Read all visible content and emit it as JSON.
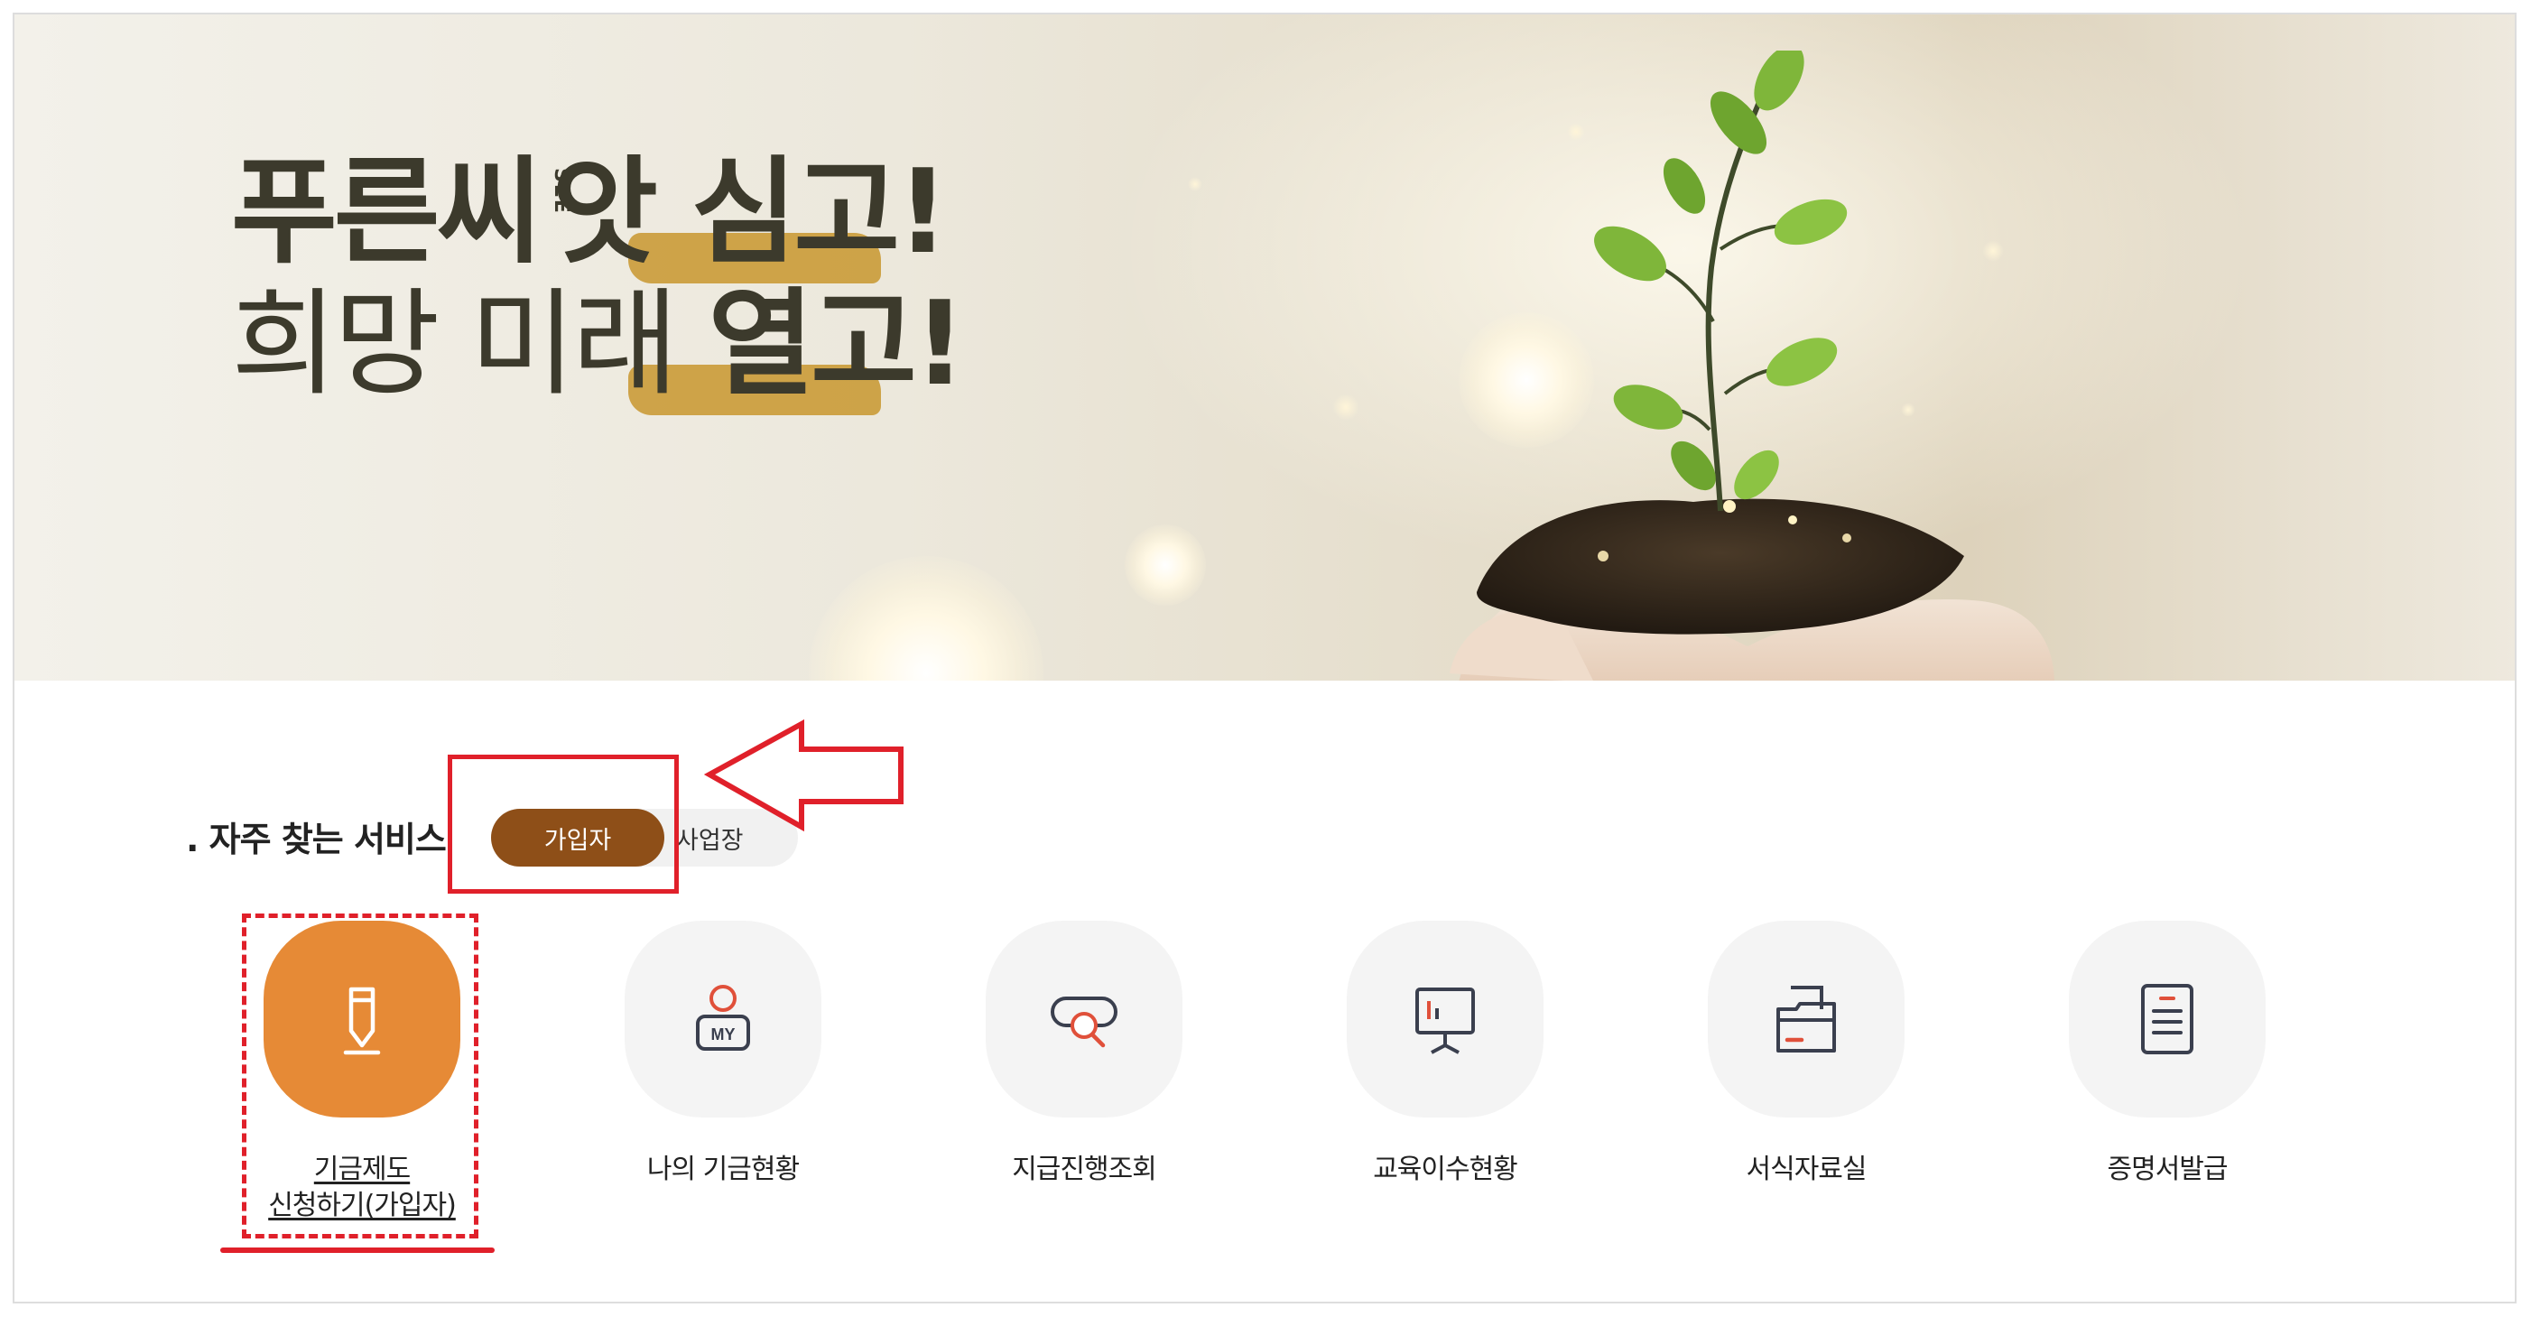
{
  "banner": {
    "headline_line1_plain": "푸른씨",
    "headline_see": "SEE",
    "headline_line1_end": "앗 심고!",
    "headline_line2_plain": "희망 미래 ",
    "headline_line2_end": "열고!"
  },
  "services": {
    "title": ". 자주 찾는 서비스",
    "toggle": {
      "active_label": "가입자",
      "inactive_label": "사업장"
    },
    "items": [
      {
        "line1": "기금제도",
        "line2": "신청하기(가입자)",
        "icon": "pencil-icon"
      },
      {
        "line1": "나의 기금현황",
        "line2": "",
        "icon": "my-profile-icon"
      },
      {
        "line1": "지급진행조회",
        "line2": "",
        "icon": "search-progress-icon"
      },
      {
        "line1": "교육이수현황",
        "line2": "",
        "icon": "presentation-board-icon"
      },
      {
        "line1": "서식자료실",
        "line2": "",
        "icon": "folder-icon"
      },
      {
        "line1": "증명서발급",
        "line2": "",
        "icon": "document-icon"
      }
    ]
  },
  "colors": {
    "active_toggle": "#8e4f18",
    "active_service": "#e68a36",
    "annotation": "#e0202a",
    "icon_accent": "#e0503a",
    "icon_stroke": "#3a3f4e"
  }
}
